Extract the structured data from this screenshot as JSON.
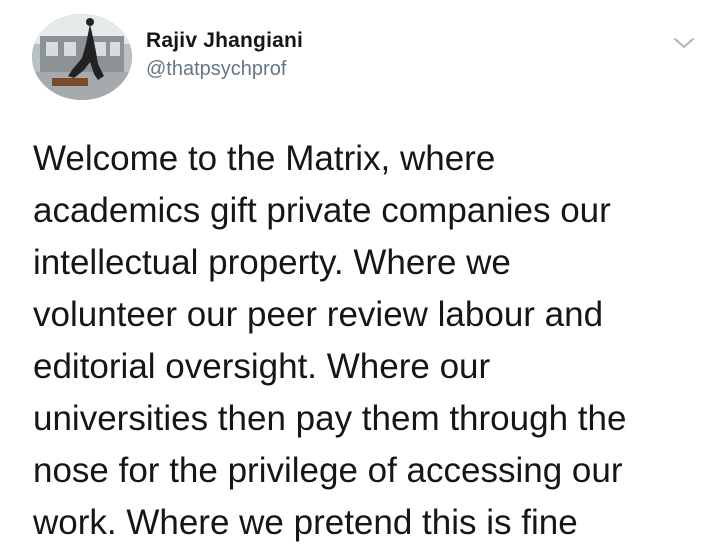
{
  "tweet": {
    "author": {
      "display_name": "Rajiv Jhangiani",
      "handle": "@thatpsychprof",
      "avatar_icon": "profile-photo"
    },
    "menu_icon": "chevron-down-icon",
    "text": "Welcome to the Matrix, where\nacademics gift private companies our\nintellectual property. Where we\nvolunteer our peer review labour and\neditorial oversight. Where our\nuniversities then pay them through the\nnose for the privilege of accessing our\nwork. Where we pretend this is fine"
  }
}
